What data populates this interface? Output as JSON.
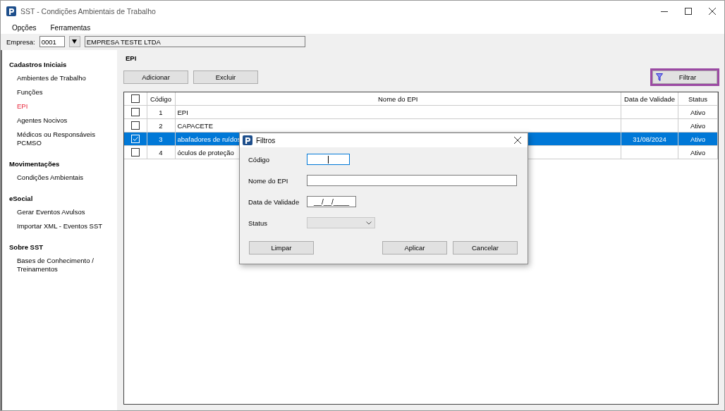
{
  "window": {
    "title": "SST - Condições Ambientais de Trabalho"
  },
  "menu": [
    "Opções",
    "Ferramentas"
  ],
  "company": {
    "label": "Empresa:",
    "code": "0001",
    "name": "EMPRESA TESTE LTDA"
  },
  "sidebar": [
    {
      "title": "Cadastros Iniciais",
      "items": [
        {
          "label": "Ambientes de Trabalho",
          "selected": false
        },
        {
          "label": "Funções",
          "selected": false
        },
        {
          "label": "EPI",
          "selected": true
        },
        {
          "label": "Agentes Nocivos",
          "selected": false
        },
        {
          "label": "Médicos ou Responsáveis PCMSO",
          "selected": false
        }
      ]
    },
    {
      "title": "Movimentações",
      "items": [
        {
          "label": "Condições Ambientais",
          "selected": false
        }
      ]
    },
    {
      "title": "eSocial",
      "items": [
        {
          "label": "Gerar Eventos Avulsos",
          "selected": false
        },
        {
          "label": "Importar XML - Eventos SST",
          "selected": false
        }
      ]
    },
    {
      "title": "Sobre SST",
      "items": [
        {
          "label": "Bases de Conhecimento / Treinamentos",
          "selected": false
        }
      ]
    }
  ],
  "page_title": "EPI",
  "buttons": [
    "Adicionar",
    "Excluir"
  ],
  "filter_button": "Filtrar",
  "table": {
    "header_checked": false,
    "columns": [
      "Código",
      "Nome do EPI",
      "Data de Validade",
      "Status"
    ],
    "rows": [
      {
        "checked": false,
        "selected": false,
        "cells": [
          "1",
          "EPI",
          "",
          "Ativo"
        ]
      },
      {
        "checked": false,
        "selected": false,
        "cells": [
          "2",
          "CAPACETE",
          "",
          "Ativo"
        ]
      },
      {
        "checked": true,
        "selected": true,
        "cells": [
          "3",
          "abafadores de ruídos",
          "31/08/2024",
          "Ativo"
        ]
      },
      {
        "checked": false,
        "selected": false,
        "cells": [
          "4",
          "óculos de proteção",
          "",
          "Ativo"
        ]
      }
    ]
  },
  "dialog": {
    "title": "Filtros",
    "fields": [
      {
        "kind": "text",
        "label": "Código",
        "focused": true
      },
      {
        "kind": "wide",
        "label": "Nome do EPI",
        "focused": false
      },
      {
        "kind": "date",
        "label": "Data de Validade",
        "value": "__/__/____",
        "focused": false
      },
      {
        "kind": "select",
        "label": "Status"
      }
    ],
    "buttons": [
      "Limpar",
      "Aplicar",
      "Cancelar"
    ]
  }
}
